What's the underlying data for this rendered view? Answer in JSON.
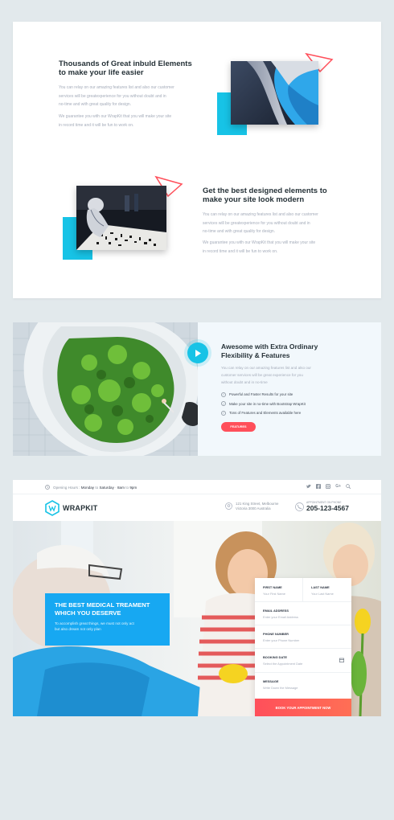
{
  "colors": {
    "accent_cyan": "#17c3e6",
    "accent_blue": "#17a8f2",
    "accent_red": "#ff4f5a",
    "heading": "#263238",
    "muted": "#a5acba"
  },
  "feature1": {
    "title_line1": "Thousands of Great inbuld Elements",
    "title_line2": "to make your life easier",
    "para1": [
      "You can relay on our amazing features list and also our customer",
      "services will be greatexperience for you without doubt and in",
      "no-time and with great quality for design."
    ],
    "para2": [
      "We guarantee you with our WrapKit that you will make your site",
      "in record time and it will be fun to work on."
    ]
  },
  "feature2": {
    "title_line1": "Get the best designed elements to",
    "title_line2": "make your site look modern",
    "para1": [
      "You can relay on our amazing features list and also our customer",
      "services will be greatexperience for you without doubt and in",
      "no-time and with great quality for design."
    ],
    "para2": [
      "We guarantee you with our WrapKit that you will make your site",
      "in record time and it will be fun to work on."
    ]
  },
  "feature3": {
    "title_line1": "Awesome with Extra Ordinary",
    "title_line2": "Flexibility & Features",
    "para": [
      "You can relay on our amazing features list and also our",
      "customer services will be great experience for you",
      "without doubt and in no-time"
    ],
    "list": [
      "Powerful and Faster Results for your site",
      "Make your site in no-time with Bootstrap WrapKit",
      "Tons of Features and Elements available here"
    ],
    "button": "FEATURES",
    "play_icon": "play-icon"
  },
  "wrapkit": {
    "topbar": {
      "label": "Opening Hours :",
      "day_from": "Monday",
      "to1": "to",
      "day_to": "Saturday",
      "sep": "·",
      "time_from": "8am",
      "to2": "to",
      "time_to": "9pm"
    },
    "socials": [
      "twitter-icon",
      "facebook-icon",
      "instagram-icon",
      "google-plus-icon",
      "search-icon"
    ],
    "logo": "WRAPKIT",
    "address": [
      "121 King Street, Melbourne",
      "Victoria 3000 Australia"
    ],
    "phone_label": "APPOINTMENT ON PHONE",
    "phone": "205-123-4567",
    "hero_title": [
      "THE BEST MEDICAL TREAMENT",
      "WHICH YOU DESERVE"
    ],
    "hero_sub": [
      "To accomplish great things, we must not only act",
      "but also dream not only plan"
    ],
    "form": {
      "first_name_label": "FIRST NAME",
      "first_name_ph": "Your First Name",
      "last_name_label": "LAST NAME",
      "last_name_ph": "Your Last Name",
      "email_label": "EMAIL ADDRESS",
      "email_ph": "Enter your Email Address",
      "phone_label": "PHONE NUMBER",
      "phone_ph": "Enter your Phone Number",
      "date_label": "BOOKING DATE",
      "date_ph": "Select the Appointment Date",
      "message_label": "MESSAGE",
      "message_ph": "Write Down the Message",
      "submit": "BOOK YOUR APPOINTMENT NOW"
    }
  }
}
